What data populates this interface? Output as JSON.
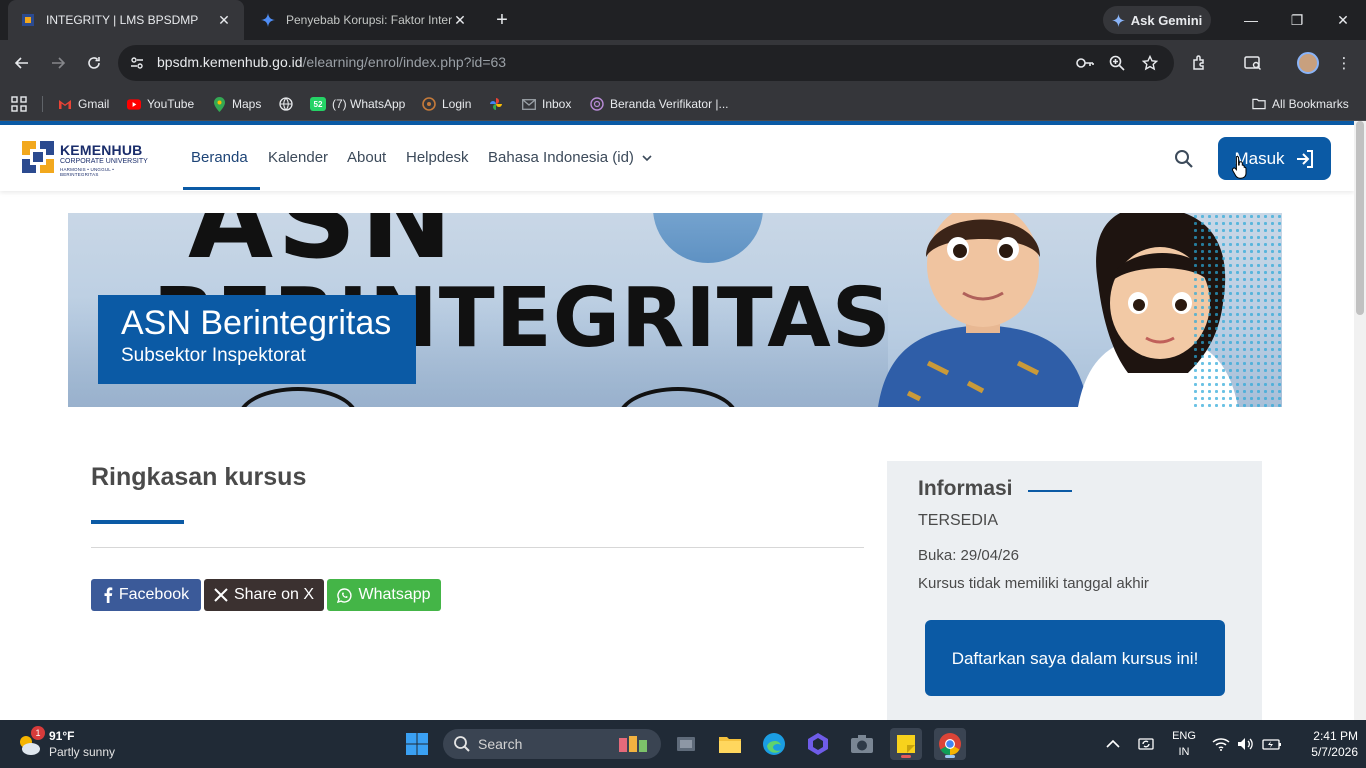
{
  "browser": {
    "tabs": [
      {
        "title": "INTEGRITY | LMS BPSDMP",
        "active": true
      },
      {
        "title": "Penyebab Korupsi: Faktor Intern",
        "active": false
      }
    ],
    "ask_gemini": "Ask Gemini",
    "url_host": "bpsdm.kemenhub.go.id",
    "url_path": "/elearning/enrol/index.php?id=63",
    "bookmarks": [
      {
        "label": "Gmail",
        "icon": "gmail-icon"
      },
      {
        "label": "YouTube",
        "icon": "youtube-icon"
      },
      {
        "label": "Maps",
        "icon": "maps-icon"
      },
      {
        "label": "",
        "icon": "globe-icon"
      },
      {
        "label": "(7) WhatsApp",
        "icon": "whatsapp-icon",
        "badge": "52"
      },
      {
        "label": "Login",
        "icon": "login-site-icon"
      },
      {
        "label": "",
        "icon": "pinwheel-icon"
      },
      {
        "label": "Inbox",
        "icon": "mail-icon"
      },
      {
        "label": "Beranda Verifikator |...",
        "icon": "site-icon"
      }
    ],
    "all_bookmarks": "All Bookmarks"
  },
  "site": {
    "logo": {
      "name": "KEMENHUB",
      "sub": "CORPORATE UNIVERSITY",
      "tagline": "HARMONIS • UNGGUL • BERINTEGRITAS"
    },
    "nav": [
      "Beranda",
      "Kalender",
      "About",
      "Helpdesk",
      "Bahasa Indonesia (id)"
    ],
    "login_label": "Masuk"
  },
  "hero": {
    "title": "ASN Berintegritas",
    "subtitle": "Subsektor Inspektorat",
    "banner_text_line1": "ASN",
    "banner_text_line2": "BERINTEGRITAS"
  },
  "summary": {
    "heading": "Ringkasan kursus",
    "share": [
      {
        "label": "Facebook",
        "icon": "facebook-icon",
        "color": "#3b5a99"
      },
      {
        "label": "Share on X",
        "icon": "x-icon",
        "color": "#3b3130"
      },
      {
        "label": "Whatsapp",
        "icon": "whatsapp-icon",
        "color": "#44b547"
      }
    ]
  },
  "info": {
    "title": "Informasi",
    "status": "TERSEDIA",
    "open": "Buka: 29/04/26",
    "end": "Kursus tidak memiliki tanggal akhir",
    "enrol_button": "Daftarkan saya dalam kursus ini!"
  },
  "taskbar": {
    "weather_temp": "91°F",
    "weather_cond": "Partly sunny",
    "weather_badge": "1",
    "search_label": "Search",
    "lang1": "ENG",
    "lang2": "IN",
    "time": "2:41 PM",
    "date": "5/7/2026"
  },
  "colors": {
    "brand_blue": "#0b5aa5",
    "facebook": "#3b5a99",
    "x": "#3b3130",
    "whatsapp": "#44b547"
  }
}
